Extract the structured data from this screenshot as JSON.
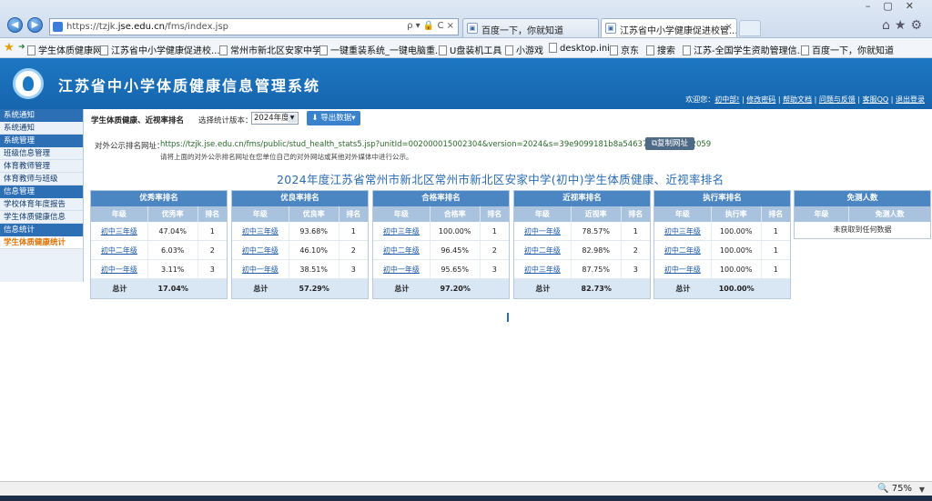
{
  "browser": {
    "url_prefix": "https://tzjk.",
    "url_domain": "jse.edu.cn",
    "url_path": "/fms/index.jsp",
    "address_icons": "ρ ▾ 🔒 C ×",
    "tabs": [
      {
        "label": "百度一下，你就知道"
      },
      {
        "label": "江苏省中小学健康促进校管..."
      }
    ],
    "favorites": [
      "学生体质健康网",
      "江苏省中小学健康促进校...",
      "常州市新北区安家中学",
      "一键重装系统_一键电脑重...",
      "U盘装机工具",
      "小游戏",
      "desktop.ini",
      "京东",
      "搜索",
      "江苏-全国学生资助管理信...",
      "百度一下，你就知道"
    ],
    "zoom": "75%"
  },
  "header": {
    "title": "江苏省中小学体质健康信息管理系统",
    "welcome": "欢迎您",
    "user": "初中部!",
    "links": [
      "修改密码",
      "帮助文档",
      "问题与反馈",
      "客服QQ",
      "退出登录"
    ]
  },
  "sidebar": {
    "sections": [
      {
        "title": "系统通知",
        "items": [
          "系统通知"
        ]
      },
      {
        "title": "系统管理",
        "items": [
          "班级信息管理",
          "体育教师管理",
          "体育教师与班级"
        ]
      },
      {
        "title": "信息管理",
        "items": [
          "学校体育年度报告",
          "学生体质健康信息"
        ]
      },
      {
        "title": "信息统计",
        "items": [
          "学生体质健康统计"
        ]
      }
    ]
  },
  "toolbar": {
    "page_label": "学生体质健康、近视率排名",
    "year_label": "选择统计版本：",
    "year_value": "2024年度",
    "export_label": "导出数据"
  },
  "public_url": {
    "label": "对外公示排名网址：",
    "value": "https://tzjk.jse.edu.cn/fms/public/stud_health_stats5.jsp?unitId=002000015002304&version=2024&s=39e9099181b8a546370de58cffb22059",
    "copy_label": "复制网址",
    "hint": "请将上面的对外公示排名网址在您单位自己的对外网站或其他对外媒体中进行公示。"
  },
  "report": {
    "title": "2024年度江苏省常州市新北区常州市新北区安家中学(初中)学生体质健康、近视率排名",
    "panels": [
      {
        "title": "优秀率排名",
        "cols": [
          "年级",
          "优秀率",
          "排名"
        ],
        "rows": [
          [
            "初中三年级",
            "47.04%",
            "1"
          ],
          [
            "初中二年级",
            "6.03%",
            "2"
          ],
          [
            "初中一年级",
            "3.11%",
            "3"
          ]
        ],
        "total": [
          "总计",
          "17.04%",
          ""
        ]
      },
      {
        "title": "优良率排名",
        "cols": [
          "年级",
          "优良率",
          "排名"
        ],
        "rows": [
          [
            "初中三年级",
            "93.68%",
            "1"
          ],
          [
            "初中二年级",
            "46.10%",
            "2"
          ],
          [
            "初中一年级",
            "38.51%",
            "3"
          ]
        ],
        "total": [
          "总计",
          "57.29%",
          ""
        ]
      },
      {
        "title": "合格率排名",
        "cols": [
          "年级",
          "合格率",
          "排名"
        ],
        "rows": [
          [
            "初中三年级",
            "100.00%",
            "1"
          ],
          [
            "初中二年级",
            "96.45%",
            "2"
          ],
          [
            "初中一年级",
            "95.65%",
            "3"
          ]
        ],
        "total": [
          "总计",
          "97.20%",
          ""
        ]
      },
      {
        "title": "近视率排名",
        "cols": [
          "年级",
          "近视率",
          "排名"
        ],
        "rows": [
          [
            "初中一年级",
            "78.57%",
            "1"
          ],
          [
            "初中二年级",
            "82.98%",
            "2"
          ],
          [
            "初中三年级",
            "87.75%",
            "3"
          ]
        ],
        "total": [
          "总计",
          "82.73%",
          ""
        ]
      },
      {
        "title": "执行率排名",
        "cols": [
          "年级",
          "执行率",
          "排名"
        ],
        "rows": [
          [
            "初中三年级",
            "100.00%",
            "1"
          ],
          [
            "初中二年级",
            "100.00%",
            "1"
          ],
          [
            "初中一年级",
            "100.00%",
            "1"
          ]
        ],
        "total": [
          "总计",
          "100.00%",
          ""
        ]
      }
    ],
    "exempt": {
      "title": "免测人数",
      "cols": [
        "年级",
        "免测人数"
      ],
      "empty": "未获取到任何数据"
    }
  }
}
